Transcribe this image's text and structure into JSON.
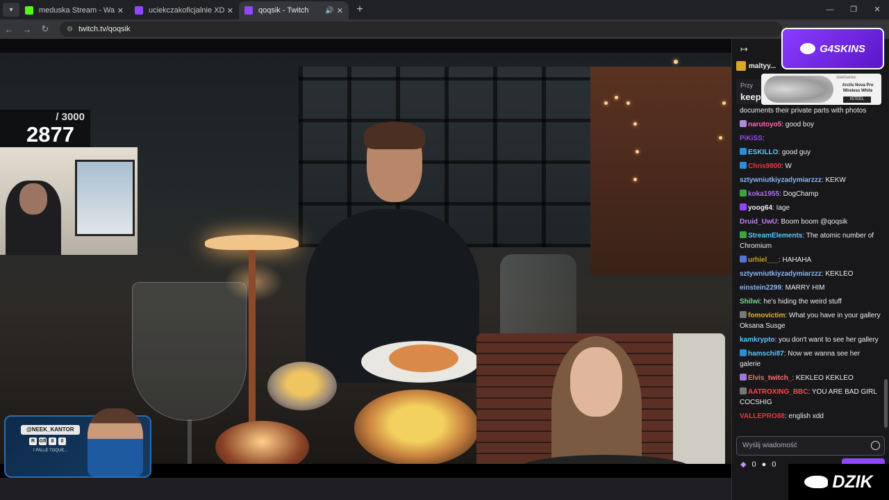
{
  "browser": {
    "tabs": [
      {
        "title": "meduska Stream - Watch Live o",
        "favicon_color": "#53fc18",
        "active": false
      },
      {
        "title": "uciekczakoficjalnie XD - Twitch",
        "favicon_color": "#9147ff",
        "active": false
      },
      {
        "title": "qoqsik - Twitch",
        "favicon_color": "#9147ff",
        "active": true
      }
    ],
    "url": "twitch.tv/qoqsik"
  },
  "stream": {
    "sub_goal_target": "/ 3000",
    "sub_goal_count": "2877",
    "promo_handle": "@NEEK_KANTOR",
    "promo_badges": [
      "R",
      "Gfl",
      "8",
      "0"
    ],
    "promo_tagline": "I PALLE TOQUE...",
    "sponsor_g4": "G4SKINS",
    "sponsor_ss_brand": "steelseries",
    "sponsor_ss_product": "Arctis Nova Pro Wireless White",
    "sponsor_ss_cta": "ISTEEL",
    "sponsor_dzik": "DZIK"
  },
  "chat": {
    "gift_user": "maltyy...",
    "pinned_label": "Przy",
    "pinned_text": "keep",
    "messages": [
      {
        "user": "",
        "color": "#efeff1",
        "text": "documents their private parts with photos",
        "badge": ""
      },
      {
        "user": "narutoyo5",
        "color": "#ff69b4",
        "text": "good boy",
        "badge": "#b28bd8"
      },
      {
        "user": "PiKiSS",
        "color": "#9147ff",
        "text": "",
        "badge": ""
      },
      {
        "user": "ESKILLO",
        "color": "#5ac8fa",
        "text": "good guy",
        "badge": "#2c8cd6"
      },
      {
        "user": "Chris9800",
        "color": "#e5393c",
        "text": "W",
        "badge": "#2c8cd6"
      },
      {
        "user": "sztywniutkiyzadymiarzzz",
        "color": "#8ab4f8",
        "text": "KEKW",
        "badge": ""
      },
      {
        "user": "koka1955",
        "color": "#b06cf5",
        "text": "DogChamp",
        "badge": "#3fa33f"
      },
      {
        "user": "yoog64",
        "color": "#efeff1",
        "text": "Iage",
        "badge": "#9147ff"
      },
      {
        "user": "Druid_UwU",
        "color": "#c77dff",
        "text": "Boom boom @qoqsik",
        "badge": ""
      },
      {
        "user": "StreamElements",
        "color": "#5ac8fa",
        "text": "The atomic number of Chromium",
        "badge": "#3fa33f"
      },
      {
        "user": "urhiel___",
        "color": "#c9a227",
        "text": "HAHAHA",
        "badge": "#5573d8"
      },
      {
        "user": "sztywniutkiyzadymiarzzz",
        "color": "#8ab4f8",
        "text": "KEKLEO",
        "badge": ""
      },
      {
        "user": "einstein2299",
        "color": "#8ab4f8",
        "text": "MARRY HIM",
        "badge": ""
      },
      {
        "user": "Shilwi",
        "color": "#6fdc8c",
        "text": "he's hiding the weird stuff",
        "badge": ""
      },
      {
        "user": "fomovictim",
        "color": "#e6b422",
        "text": "What you have in your gallery Oksana Susge",
        "badge": "#777777"
      },
      {
        "user": "kamkrypto",
        "color": "#5ac8fa",
        "text": "you don't want to see her gallery",
        "badge": ""
      },
      {
        "user": "hamschi87",
        "color": "#5ac8fa",
        "text": "Now we wanna see her galerie",
        "badge": "#2c8cd6"
      },
      {
        "user": "Elvis_twitch_",
        "color": "#ff6e6e",
        "text": "KEKLEO KEKLEO",
        "badge": "#9b7ad8"
      },
      {
        "user": "AATROXING_BBC",
        "color": "#ff4545",
        "text": "YOU ARE BAD GIRL COCSHIG",
        "badge": "#777777"
      },
      {
        "user": "VALLEPRO88",
        "color": "#e5393c",
        "text": "english xdd",
        "badge": ""
      }
    ],
    "input_placeholder": "Wyślij wiadomość",
    "points_a": "0",
    "points_b": "0"
  }
}
